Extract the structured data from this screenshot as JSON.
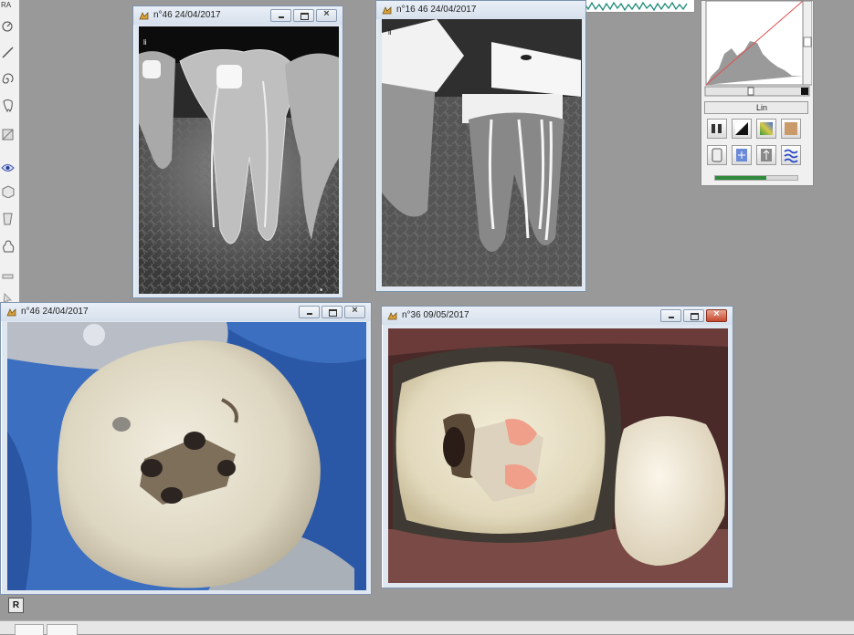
{
  "toolbar_label": "RA",
  "windows": [
    {
      "id": "xray-46",
      "title": "n°46 24/04/2017",
      "image_icon": "xray-46-image",
      "has_scale_tag": true
    },
    {
      "id": "xray-16-46",
      "title": "n°16 46 24/04/2017",
      "image_icon": "xray-16-46-image"
    },
    {
      "id": "photo-46",
      "title": "n°46 24/04/2017",
      "image_icon": "photo-46-image"
    },
    {
      "id": "photo-36",
      "title": "n°36 09/05/2017",
      "image_icon": "photo-36-image"
    }
  ],
  "histogram": {
    "mode_label": "Lin",
    "controls": [
      "hist-lock-icon",
      "contrast-icon",
      "gradient-icon",
      "sepia-icon",
      "keypad-icon",
      "filter-icon",
      "level-icon",
      "pattern-icon"
    ]
  },
  "bottom_button_label": "R",
  "colors": {
    "desktop": "#999999",
    "window_frame": "#dfe7f1",
    "close_red": "#c7472c",
    "progress_green": "#2f8a3b"
  }
}
